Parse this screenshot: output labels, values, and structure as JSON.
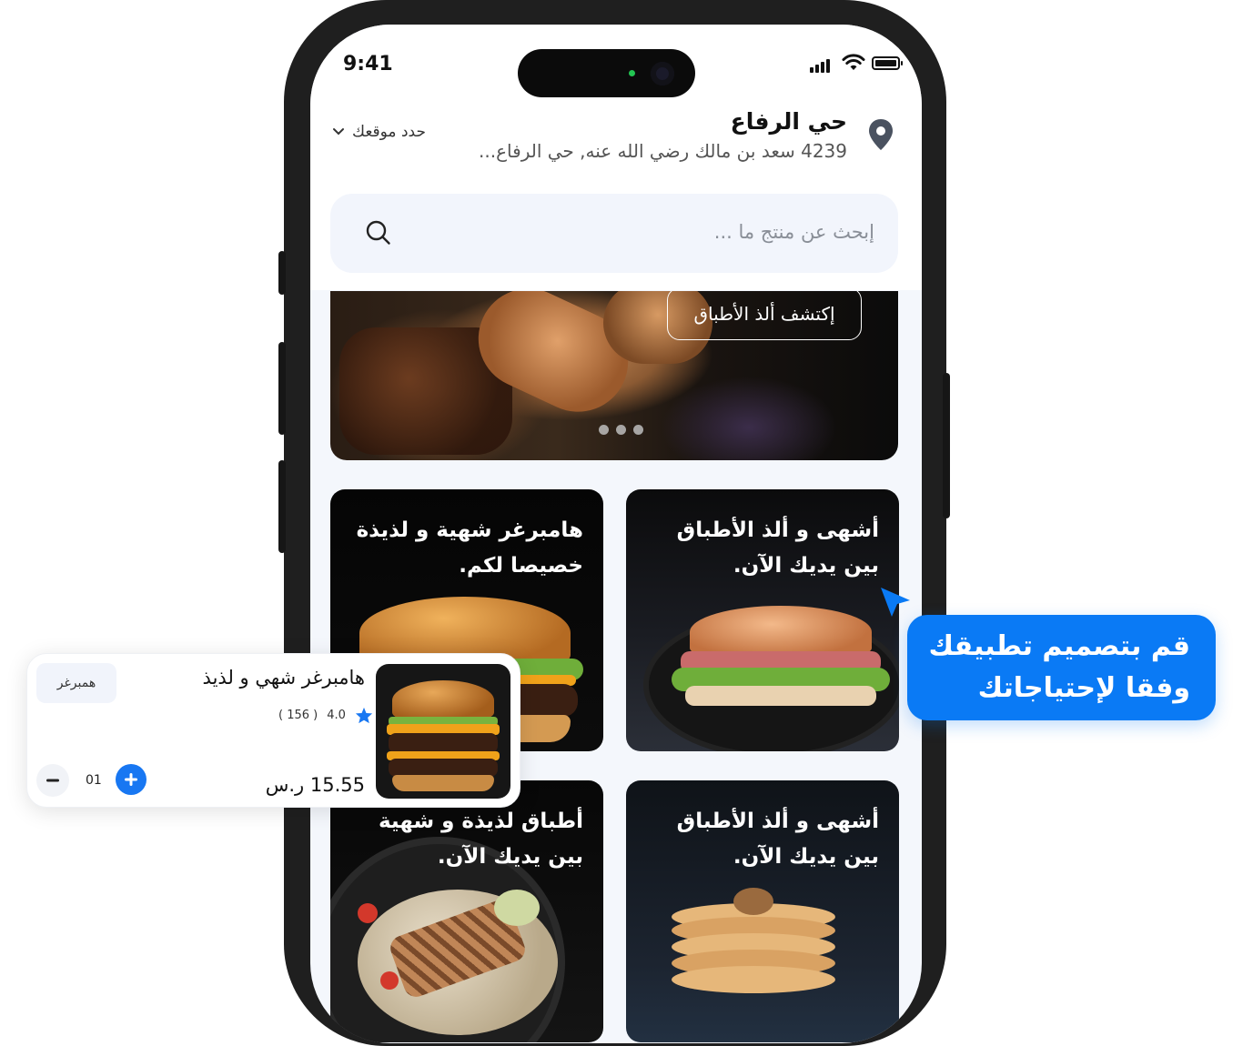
{
  "status_bar": {
    "time": "9:41"
  },
  "location": {
    "title": "حي الرفاع",
    "address": "4239 سعد بن مالك رضي الله عنه, حي الرفاع...",
    "select_label": "حدد موقعك"
  },
  "search": {
    "placeholder": "إبحث عن منتج ما ..."
  },
  "banner": {
    "button_label": "إكتشف ألذ الأطباق",
    "slides": 3
  },
  "cards": [
    {
      "text": "أشهى و ألذ الأطباق بين يديك الآن.",
      "image": "sandwich"
    },
    {
      "text": "هامبرغر شهية و لذيذة خصيصا لكم.",
      "image": "burger"
    },
    {
      "text": "أشهى و ألذ الأطباق بين يديك الآن.",
      "image": "pancakes"
    },
    {
      "text": "أطباق لذيذة و شهية بين يديك الآن.",
      "image": "salmon-salad"
    }
  ],
  "product_popup": {
    "title": "هامبرغر شهي و لذيذ",
    "tag": "همبرغر",
    "rating": "4.0",
    "reviews": "( 156 )",
    "price": "15.55 ر.س",
    "quantity": "01",
    "icons": [
      "star-icon",
      "minus-icon",
      "plus-icon"
    ]
  },
  "bubble": {
    "line1": "قم بتصميم تطبيقك",
    "line2": "وفقا لإحتياجاتك"
  },
  "colors": {
    "accent": "#0a7af5",
    "phone_frame": "#1f1f1f",
    "screen_bg": "#f4f7fc"
  }
}
